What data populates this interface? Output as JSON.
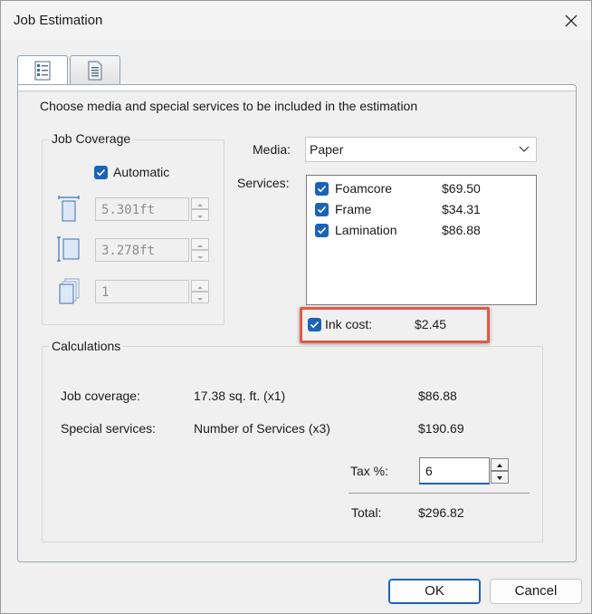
{
  "window": {
    "title": "Job Estimation"
  },
  "tabs": [
    {
      "name": "estimation",
      "icon": "checklist-icon",
      "active": true
    },
    {
      "name": "details",
      "icon": "document-icon",
      "active": false
    }
  ],
  "instruction": "Choose media and special services to be included in the estimation",
  "job_coverage": {
    "label": "Job Coverage",
    "automatic_label": "Automatic",
    "automatic_checked": true,
    "width_value": "5.301ft",
    "height_value": "3.278ft",
    "copies_value": "1"
  },
  "media": {
    "label": "Media:",
    "selected": "Paper"
  },
  "services": {
    "label": "Services:",
    "items": [
      {
        "name": "Foamcore",
        "price": "$69.50",
        "checked": true
      },
      {
        "name": "Frame",
        "price": "$34.31",
        "checked": true
      },
      {
        "name": "Lamination",
        "price": "$86.88",
        "checked": true
      }
    ]
  },
  "ink": {
    "label": "Ink cost:",
    "value": "$2.45",
    "checked": true
  },
  "calculations": {
    "label": "Calculations",
    "job_coverage_label": "Job coverage:",
    "job_coverage_detail": "17.38 sq. ft. (x1)",
    "job_coverage_amount": "$86.88",
    "special_services_label": "Special services:",
    "special_services_detail": "Number of Services (x3)",
    "special_services_amount": "$190.69",
    "tax_label": "Tax %:",
    "tax_value": "6",
    "total_label": "Total:",
    "total_value": "$296.82"
  },
  "buttons": {
    "ok": "OK",
    "cancel": "Cancel"
  },
  "colors": {
    "accent": "#1a63b8",
    "highlight": "#e05a47"
  }
}
